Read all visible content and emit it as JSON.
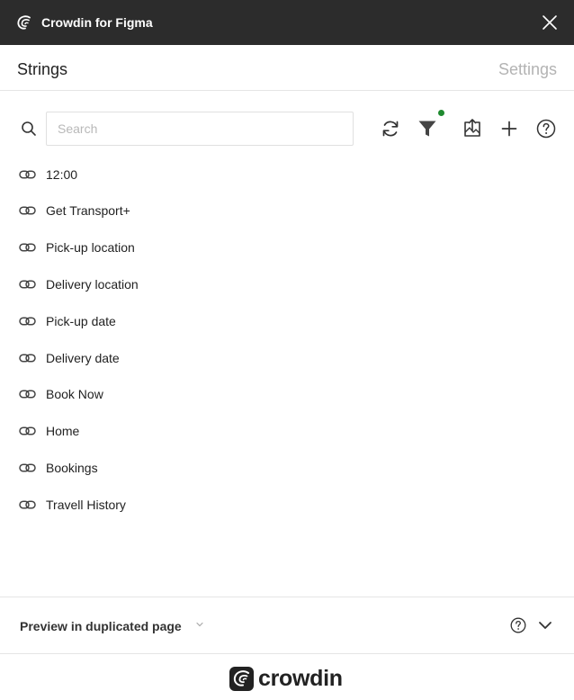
{
  "window": {
    "title": "Crowdin for Figma",
    "logo_icon": "crowdin-logo-icon",
    "close_icon": "close-icon"
  },
  "tabs": [
    {
      "label": "Strings",
      "active": true
    },
    {
      "label": "Settings",
      "active": false
    }
  ],
  "search": {
    "placeholder": "Search",
    "value": "",
    "icon": "search-icon"
  },
  "toolbar": {
    "icons": [
      "refresh-icon",
      "filter-icon",
      "export-icon",
      "add-icon",
      "help-icon"
    ],
    "filter_active_color": "#1f8a2f"
  },
  "strings": [
    {
      "label": "12:00"
    },
    {
      "label": "Get Transport+"
    },
    {
      "label": "Pick-up location"
    },
    {
      "label": "Delivery location"
    },
    {
      "label": "Pick-up date"
    },
    {
      "label": "Delivery date"
    },
    {
      "label": "Book Now"
    },
    {
      "label": "Home"
    },
    {
      "label": "Bookings"
    },
    {
      "label": "Travell History"
    }
  ],
  "preview": {
    "label": "Preview in duplicated page",
    "icons": [
      "chevron-down-icon",
      "help-icon",
      "chevron-down-icon"
    ]
  },
  "brand": {
    "wordmark": "crowdin"
  },
  "colors": {
    "titlebar_bg": "#2c2c2c",
    "accent_dot": "#1f8a2f",
    "muted_text": "#b3b3b3"
  }
}
